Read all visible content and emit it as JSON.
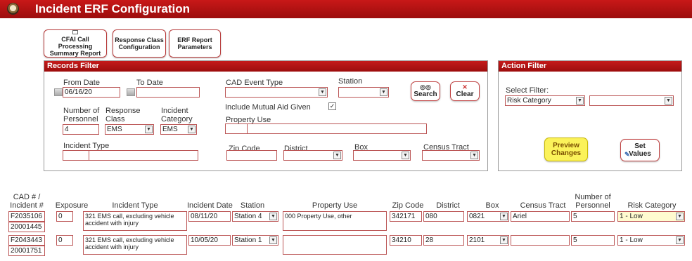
{
  "title": "Incident ERF Configuration",
  "toolbar": {
    "cfai_report": [
      "CFAI Call Processing",
      "Summary Report"
    ],
    "response_class": [
      "Response Class",
      "Configuration"
    ],
    "erf_report": [
      "ERF Report",
      "Parameters"
    ]
  },
  "records_filter": {
    "heading": "Records Filter",
    "from_date_label": "From Date",
    "from_date_value": "06/16/20",
    "to_date_label": "To Date",
    "to_date_value": "",
    "cad_event_type_label": "CAD Event Type",
    "cad_event_type_value": "",
    "station_label": "Station",
    "station_value": "",
    "search_label": "Search",
    "clear_label": "Clear",
    "num_personnel_label": [
      "Number of",
      "Personnel"
    ],
    "num_personnel_value": "4",
    "response_class_label": [
      "Response",
      "Class"
    ],
    "response_class_value": "EMS",
    "incident_category_label": [
      "Incident",
      "Category"
    ],
    "incident_category_value": "EMS",
    "mutual_aid_label": "Include Mutual Aid Given",
    "mutual_aid_checked": true,
    "property_use_label": "Property Use",
    "incident_type_label": "Incident Type",
    "zip_code_label": "Zip Code",
    "district_label": "District",
    "box_label": "Box",
    "census_tract_label": "Census Tract"
  },
  "action_filter": {
    "heading": "Action Filter",
    "select_filter_label": "Select Filter:",
    "select_filter_value": "Risk Category",
    "secondary_value": "",
    "preview_label": [
      "Preview",
      "Changes"
    ],
    "set_values_label": [
      "Set",
      "Values"
    ]
  },
  "table": {
    "headers": {
      "cad": [
        "CAD # /",
        "Incident #"
      ],
      "exposure": "Exposure",
      "incident_type": "Incident Type",
      "incident_date": "Incident Date",
      "station": "Station",
      "property_use": "Property Use",
      "zip_code": "Zip Code",
      "district": "District",
      "box": "Box",
      "census_tract": "Census Tract",
      "num_personnel": [
        "Number of",
        "Personnel"
      ],
      "risk_category": "Risk Category"
    },
    "rows": [
      {
        "cad": "F2035106",
        "incident_no": "20001445",
        "exposure": "0",
        "incident_type": "321 EMS call, excluding vehicle accident with injury",
        "incident_date": "08/11/20",
        "station": "Station 4",
        "property_use": "000 Property Use, other",
        "zip_code": "342171",
        "district": "080",
        "box": "0821",
        "census_tract": "Ariel",
        "num_personnel": "5",
        "risk_category": "1 - Low"
      },
      {
        "cad": "F2043443",
        "incident_no": "20001751",
        "exposure": "0",
        "incident_type": "321 EMS call, excluding vehicle accident with injury",
        "incident_date": "10/05/20",
        "station": "Station 1",
        "property_use": "",
        "zip_code": "34210",
        "district": "28",
        "box": "2101",
        "census_tract": "",
        "num_personnel": "5",
        "risk_category": "1 - Low"
      }
    ]
  },
  "colors": {
    "header_red": "#b11212",
    "field_border": "#bb5555",
    "preview_highlight": "#fbf25a",
    "risk_highlight": "#fffbd0"
  }
}
